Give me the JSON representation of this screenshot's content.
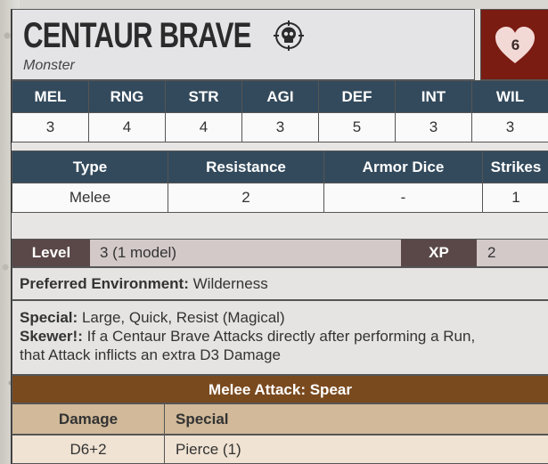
{
  "card": {
    "title": "CENTAUR BRAVE",
    "subtitle": "Monster",
    "cost": "6",
    "colors": {
      "stat_header": "#334a5c",
      "cost_bg": "#7a1c12",
      "attack_header": "#7a4a1f",
      "level_label": "#5a4747"
    }
  },
  "stats": {
    "headers": [
      "MEL",
      "RNG",
      "STR",
      "AGI",
      "DEF",
      "INT",
      "WIL"
    ],
    "values": [
      "3",
      "4",
      "4",
      "3",
      "5",
      "3",
      "3"
    ]
  },
  "attributes": {
    "headers": [
      "Type",
      "Resistance",
      "Armor Dice",
      "Strikes"
    ],
    "values": [
      "Melee",
      "2",
      "-",
      "1"
    ]
  },
  "level": {
    "label": "Level",
    "value": "3 (1 model)",
    "xp_label": "XP",
    "xp_value": "2"
  },
  "environment": {
    "label": "Preferred Environment:",
    "value": "Wilderness"
  },
  "special": {
    "label": "Special:",
    "value": "Large, Quick, Resist (Magical)",
    "ability_label": "Skewer!:",
    "ability_text_line1": "If a Centaur Brave Attacks directly after performing a Run,",
    "ability_text_line2": "that Attack inflicts an extra D3 Damage"
  },
  "attack": {
    "title": "Melee Attack: Spear",
    "damage_label": "Damage",
    "special_label": "Special",
    "damage_value": "D6+2",
    "special_value": "Pierce (1)"
  },
  "icons": {
    "type_icon": "skull-crosshair-icon",
    "cost_icon": "heart-icon"
  }
}
